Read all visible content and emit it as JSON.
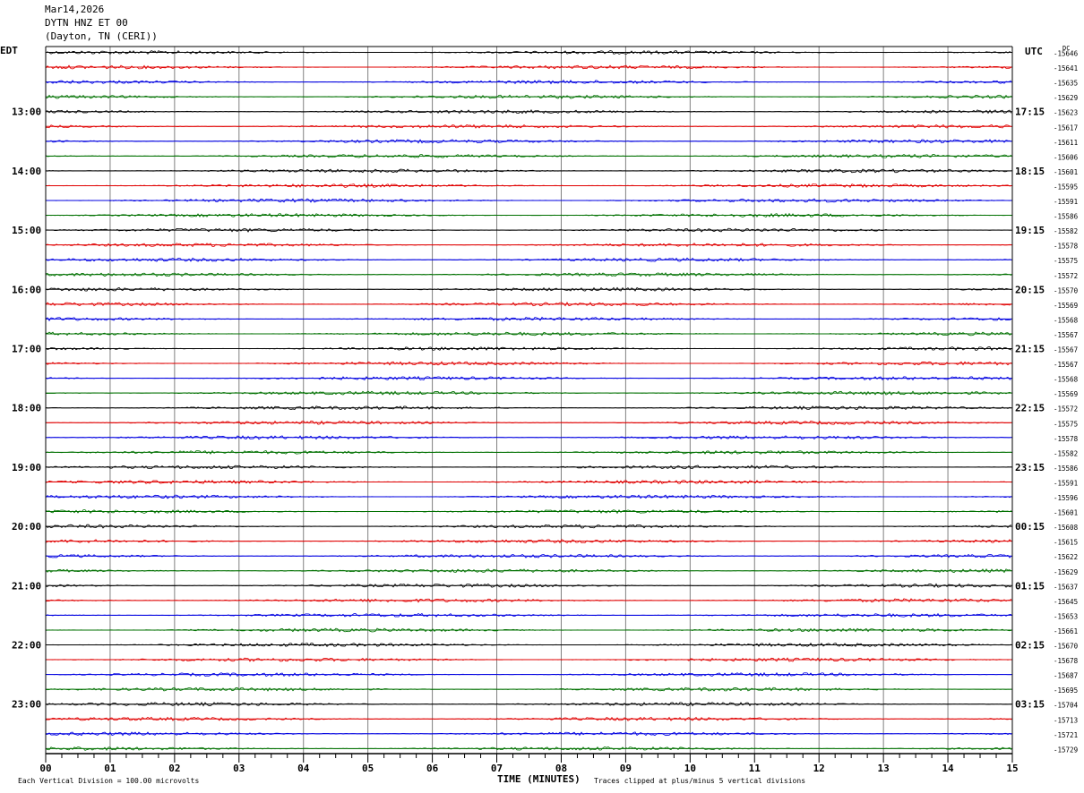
{
  "header": {
    "date": "Mar14,2026",
    "station": "DYTN HNZ ET 00",
    "location": "(Dayton, TN (CERI))"
  },
  "labels": {
    "left_zone": "EDT",
    "right_zone": "UTC",
    "dc": "DC",
    "xlabel": "TIME (MINUTES)",
    "vertical_division": "Each Vertical Division =  100.00 microvolts",
    "clip_note": "Traces clipped at plus/minus 5 vertical divisions"
  },
  "chart_data": {
    "type": "line",
    "title": "DYTN HNZ ET 00",
    "xlabel": "TIME (MINUTES)",
    "ylabel": "",
    "xlim": [
      0,
      15
    ],
    "x_ticks": [
      "00",
      "01",
      "02",
      "03",
      "04",
      "05",
      "06",
      "07",
      "08",
      "09",
      "10",
      "11",
      "12",
      "13",
      "14",
      "15"
    ],
    "left_hour_labels": [
      "13:00",
      "14:00",
      "15:00",
      "16:00",
      "17:00",
      "18:00",
      "19:00",
      "20:00",
      "21:00",
      "22:00",
      "23:00"
    ],
    "right_hour_labels": [
      "17:15",
      "18:15",
      "19:15",
      "20:15",
      "21:15",
      "22:15",
      "23:15",
      "00:15",
      "01:15",
      "02:15",
      "03:15"
    ],
    "trace_colors": [
      "#000000",
      "#e00000",
      "#0000e0",
      "#007000"
    ],
    "dc_offsets": [
      -15646,
      -15641,
      -15635,
      -15629,
      -15623,
      -15617,
      -15611,
      -15606,
      -15601,
      -15595,
      -15591,
      -15586,
      -15582,
      -15578,
      -15575,
      -15572,
      -15570,
      -15569,
      -15568,
      -15567,
      -15567,
      -15567,
      -15568,
      -15569,
      -15572,
      -15575,
      -15578,
      -15582,
      -15586,
      -15591,
      -15596,
      -15601,
      -15608,
      -15615,
      -15622,
      -15629,
      -15637,
      -15645,
      -15653,
      -15661,
      -15670,
      -15678,
      -15687,
      -15695,
      -15704,
      -15713,
      -15721,
      -15729
    ],
    "grid": true
  }
}
